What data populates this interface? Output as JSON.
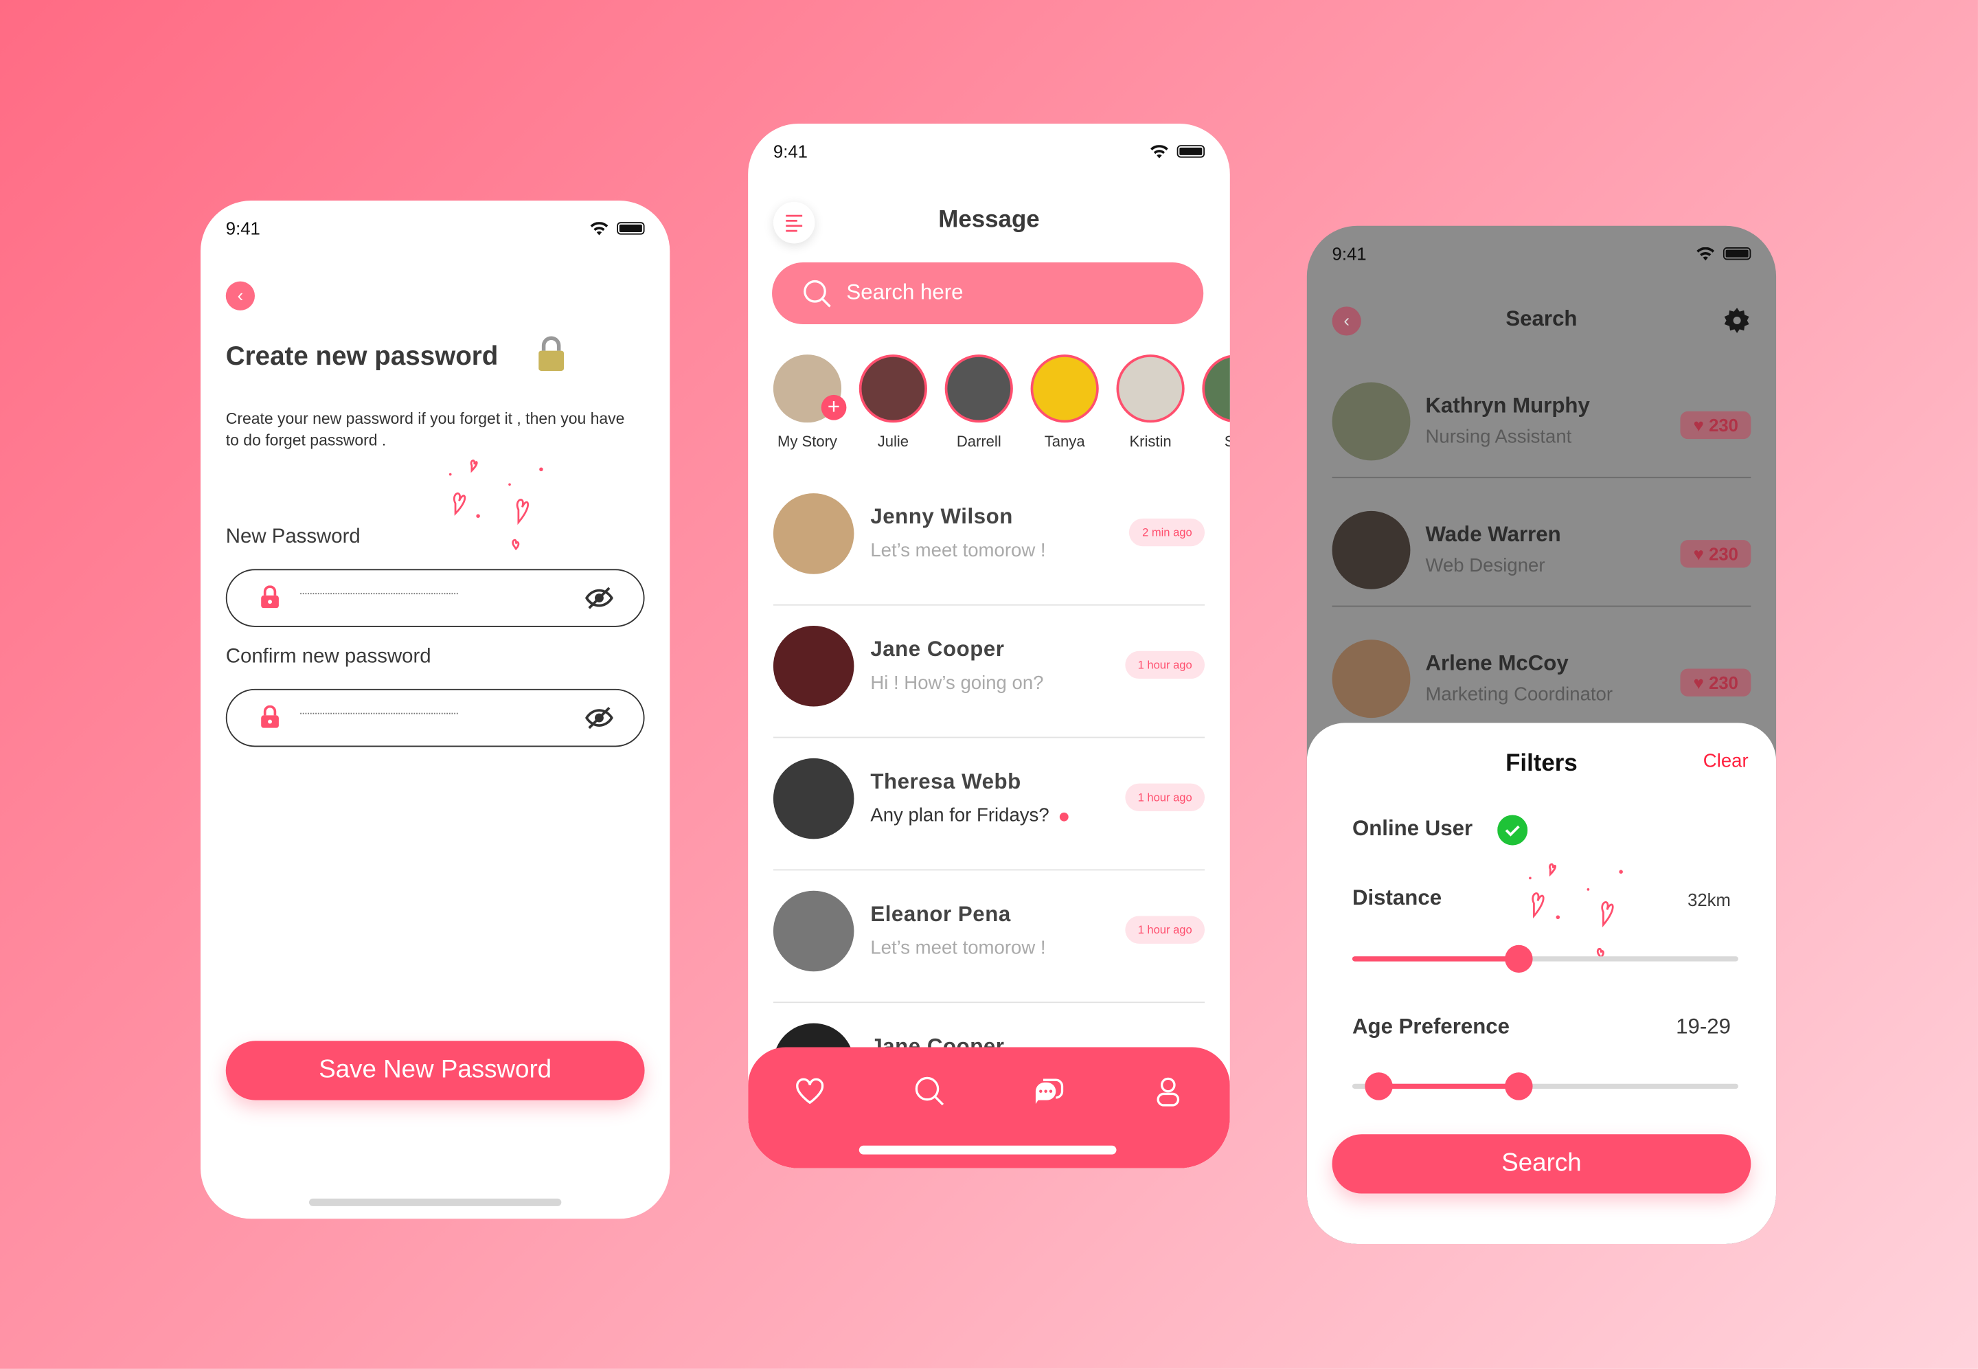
{
  "colors": {
    "accent": "#ff4f6e",
    "online": "#1ec337",
    "clear": "#ff1f3d"
  },
  "screen1": {
    "time": "9:41",
    "title": "Create new password",
    "description": "Create your new password if you forget it , then you have to do forget password .",
    "new_password_label": "New Password",
    "confirm_password_label": "Confirm new password",
    "save_button": "Save New Password",
    "icons": [
      "back-chevron-icon",
      "padlock-icon",
      "lock-icon",
      "eye-off-icon"
    ]
  },
  "screen2": {
    "time": "9:41",
    "title": "Message",
    "search_placeholder": "Search here",
    "stories": [
      {
        "name": "My Story",
        "color": "#c9b49a"
      },
      {
        "name": "Julie",
        "color": "#6b3b3b"
      },
      {
        "name": "Darrell",
        "color": "#555555"
      },
      {
        "name": "Tanya",
        "color": "#f3c414"
      },
      {
        "name": "Kristin",
        "color": "#d8d2c8"
      },
      {
        "name": "Ser",
        "color": "#5a7a54"
      }
    ],
    "messages": [
      {
        "name": "Jenny Wilson",
        "text": "Let’s meet tomorow !",
        "time": "2 min ago",
        "unread": false,
        "color": "#c9a57a"
      },
      {
        "name": "Jane Cooper",
        "text": "Hi ! How’s going on?",
        "time": "1 hour ago",
        "unread": false,
        "color": "#5b1f22"
      },
      {
        "name": "Theresa Webb",
        "text": "Any plan for Fridays?",
        "time": "1 hour ago",
        "unread": true,
        "color": "#3a3a3a"
      },
      {
        "name": "Eleanor Pena",
        "text": "Let’s meet tomorow !",
        "time": "1 hour ago",
        "unread": false,
        "color": "#777777"
      },
      {
        "name": "Jane Cooper",
        "text": "",
        "time": "",
        "unread": false,
        "color": "#222222"
      }
    ],
    "nav": [
      "heart-icon",
      "search-icon",
      "chat-icon",
      "profile-icon"
    ]
  },
  "screen3": {
    "time": "9:41",
    "title": "Search",
    "people": [
      {
        "name": "Kathryn Murphy",
        "role": "Nursing Assistant",
        "likes": "230",
        "color": "#6a6f5a"
      },
      {
        "name": "Wade Warren",
        "role": "Web Designer",
        "likes": "230",
        "color": "#3d3530"
      },
      {
        "name": "Arlene McCoy",
        "role": "Marketing Coordinator",
        "likes": "230",
        "color": "#8a6a50"
      }
    ],
    "filters": {
      "title": "Filters",
      "clear": "Clear",
      "online_user": "Online User",
      "online_checked": true,
      "distance_label": "Distance",
      "distance_value": "32km",
      "distance_fraction": 0.43,
      "age_label": "Age Preference",
      "age_value": "19-29",
      "age_low_fraction": 0.07,
      "age_high_fraction": 0.43,
      "search_button": "Search"
    }
  }
}
